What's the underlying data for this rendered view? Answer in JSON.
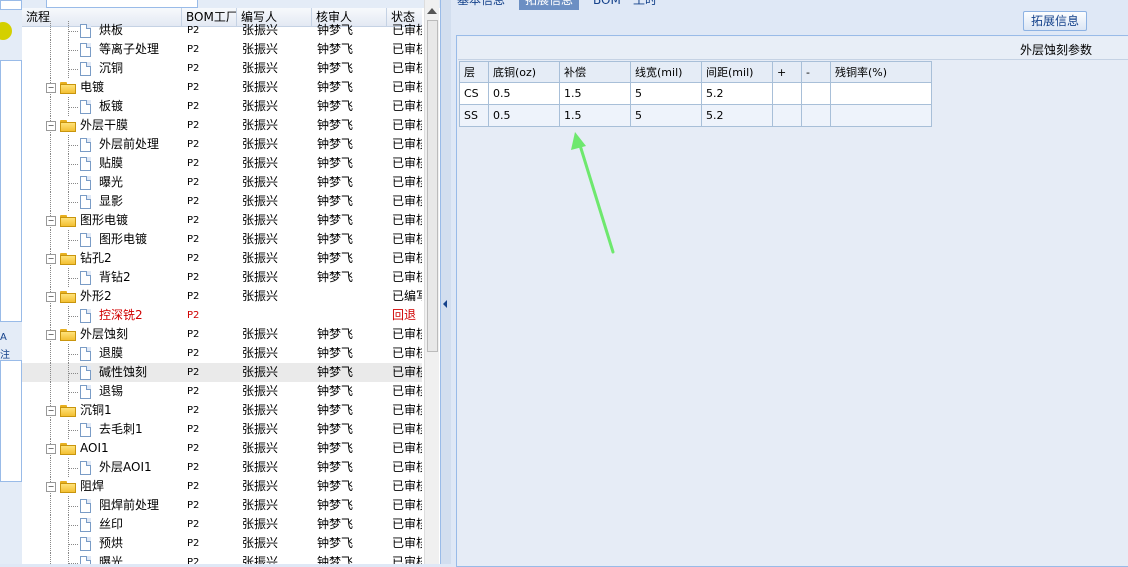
{
  "tree": {
    "columns": [
      "流程",
      "BOM工厂",
      "编写人",
      "核审人",
      "状态"
    ],
    "rows": [
      {
        "name": "烘板",
        "factory": "P2",
        "writer": "张振兴",
        "reviewer": "钟梦飞",
        "status": "已审核",
        "level": 2,
        "type": "doc"
      },
      {
        "name": "等离子处理",
        "factory": "P2",
        "writer": "张振兴",
        "reviewer": "钟梦飞",
        "status": "已审核",
        "level": 2,
        "type": "doc"
      },
      {
        "name": "沉铜",
        "factory": "P2",
        "writer": "张振兴",
        "reviewer": "钟梦飞",
        "status": "已审核",
        "level": 2,
        "type": "doc"
      },
      {
        "name": "电镀",
        "factory": "P2",
        "writer": "张振兴",
        "reviewer": "钟梦飞",
        "status": "已审核",
        "level": 1,
        "type": "folder"
      },
      {
        "name": "板镀",
        "factory": "P2",
        "writer": "张振兴",
        "reviewer": "钟梦飞",
        "status": "已审核",
        "level": 2,
        "type": "doc"
      },
      {
        "name": "外层干膜",
        "factory": "P2",
        "writer": "张振兴",
        "reviewer": "钟梦飞",
        "status": "已审核",
        "level": 1,
        "type": "folder"
      },
      {
        "name": "外层前处理",
        "factory": "P2",
        "writer": "张振兴",
        "reviewer": "钟梦飞",
        "status": "已审核",
        "level": 2,
        "type": "doc"
      },
      {
        "name": "贴膜",
        "factory": "P2",
        "writer": "张振兴",
        "reviewer": "钟梦飞",
        "status": "已审核",
        "level": 2,
        "type": "doc"
      },
      {
        "name": "曝光",
        "factory": "P2",
        "writer": "张振兴",
        "reviewer": "钟梦飞",
        "status": "已审核",
        "level": 2,
        "type": "doc"
      },
      {
        "name": "显影",
        "factory": "P2",
        "writer": "张振兴",
        "reviewer": "钟梦飞",
        "status": "已审核",
        "level": 2,
        "type": "doc"
      },
      {
        "name": "图形电镀",
        "factory": "P2",
        "writer": "张振兴",
        "reviewer": "钟梦飞",
        "status": "已审核",
        "level": 1,
        "type": "folder"
      },
      {
        "name": "图形电镀",
        "factory": "P2",
        "writer": "张振兴",
        "reviewer": "钟梦飞",
        "status": "已审核",
        "level": 2,
        "type": "doc"
      },
      {
        "name": "钻孔2",
        "factory": "P2",
        "writer": "张振兴",
        "reviewer": "钟梦飞",
        "status": "已审核",
        "level": 1,
        "type": "folder"
      },
      {
        "name": "背钻2",
        "factory": "P2",
        "writer": "张振兴",
        "reviewer": "钟梦飞",
        "status": "已审核",
        "level": 2,
        "type": "doc"
      },
      {
        "name": "外形2",
        "factory": "P2",
        "writer": "张振兴",
        "reviewer": "",
        "status": "已编写",
        "level": 1,
        "type": "folder"
      },
      {
        "name": "控深铣2",
        "factory": "P2",
        "writer": "",
        "reviewer": "",
        "status": "回退",
        "level": 2,
        "type": "doc",
        "red": true
      },
      {
        "name": "外层蚀刻",
        "factory": "P2",
        "writer": "张振兴",
        "reviewer": "钟梦飞",
        "status": "已审核",
        "level": 1,
        "type": "folder"
      },
      {
        "name": "退膜",
        "factory": "P2",
        "writer": "张振兴",
        "reviewer": "钟梦飞",
        "status": "已审核",
        "level": 2,
        "type": "doc"
      },
      {
        "name": "碱性蚀刻",
        "factory": "P2",
        "writer": "张振兴",
        "reviewer": "钟梦飞",
        "status": "已审核",
        "level": 2,
        "type": "doc",
        "selected": true
      },
      {
        "name": "退锡",
        "factory": "P2",
        "writer": "张振兴",
        "reviewer": "钟梦飞",
        "status": "已审核",
        "level": 2,
        "type": "doc"
      },
      {
        "name": "沉铜1",
        "factory": "P2",
        "writer": "张振兴",
        "reviewer": "钟梦飞",
        "status": "已审核",
        "level": 1,
        "type": "folder"
      },
      {
        "name": "去毛刺1",
        "factory": "P2",
        "writer": "张振兴",
        "reviewer": "钟梦飞",
        "status": "已审核",
        "level": 2,
        "type": "doc"
      },
      {
        "name": "AOI1",
        "factory": "P2",
        "writer": "张振兴",
        "reviewer": "钟梦飞",
        "status": "已审核",
        "level": 1,
        "type": "folder"
      },
      {
        "name": "外层AOI1",
        "factory": "P2",
        "writer": "张振兴",
        "reviewer": "钟梦飞",
        "status": "已审核",
        "level": 2,
        "type": "doc"
      },
      {
        "name": "阻焊",
        "factory": "P2",
        "writer": "张振兴",
        "reviewer": "钟梦飞",
        "status": "已审核",
        "level": 1,
        "type": "folder"
      },
      {
        "name": "阻焊前处理",
        "factory": "P2",
        "writer": "张振兴",
        "reviewer": "钟梦飞",
        "status": "已审核",
        "level": 2,
        "type": "doc"
      },
      {
        "name": "丝印",
        "factory": "P2",
        "writer": "张振兴",
        "reviewer": "钟梦飞",
        "status": "已审核",
        "level": 2,
        "type": "doc"
      },
      {
        "name": "预烘",
        "factory": "P2",
        "writer": "张振兴",
        "reviewer": "钟梦飞",
        "status": "已审核",
        "level": 2,
        "type": "doc"
      },
      {
        "name": "曝光",
        "factory": "P2",
        "writer": "张振兴",
        "reviewer": "钟梦飞",
        "status": "已审核",
        "level": 2,
        "type": "doc"
      }
    ]
  },
  "left_strip": {
    "label_a": "A",
    "label_b": "注"
  },
  "right": {
    "tabs": [
      "基本信息",
      "拓展信息",
      "BOM",
      "工时"
    ],
    "active_tab": 1,
    "ext_button": "拓展信息",
    "section_title": "外层蚀刻参数",
    "table": {
      "headers": [
        "层",
        "底铜(oz)",
        "补偿",
        "线宽(mil)",
        "间距(mil)",
        "+",
        "-",
        "残铜率(%)"
      ],
      "rows": [
        [
          "CS",
          "0.5",
          "1.5",
          "5",
          "5.2",
          "",
          "",
          ""
        ],
        [
          "SS",
          "0.5",
          "1.5",
          "5",
          "5.2",
          "",
          "",
          ""
        ]
      ]
    }
  },
  "colors": {
    "arrow": "#6ee86e",
    "accent": "#99bbe8",
    "red_text": "#d00000",
    "layer_cell": "#f9c36a"
  }
}
